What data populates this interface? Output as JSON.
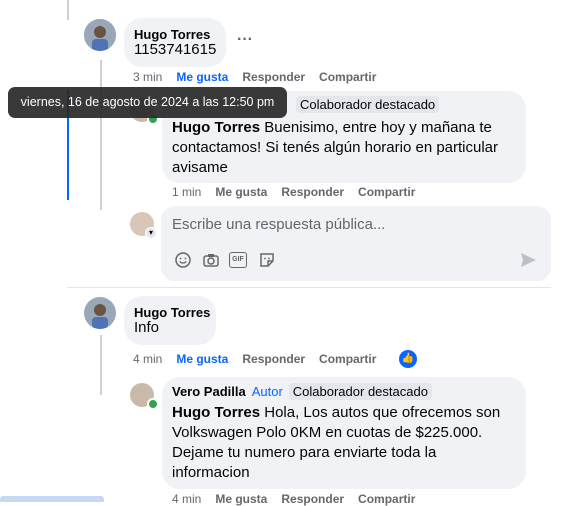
{
  "comments": [
    {
      "author": "Hugo Torres",
      "text": "1153741615",
      "meta": {
        "time": "3 min",
        "like": "Me gusta",
        "reply": "Responder",
        "share": "Compartir"
      },
      "more_glyph": "···"
    },
    {
      "author": "Hugo Torres",
      "text": "Info",
      "meta": {
        "time": "4 min",
        "like": "Me gusta",
        "reply": "Responder",
        "share": "Compartir"
      }
    }
  ],
  "replies": [
    {
      "badge": "Colaborador destacado",
      "mention": "Hugo Torres",
      "text": " Buenisimo, entre hoy y mañana te contactamos! Si tenés algún horario en particular avisame",
      "meta": {
        "time": "1 min",
        "like": "Me gusta",
        "reply": "Responder",
        "share": "Compartir"
      }
    },
    {
      "author": "Vero Padilla",
      "role": "Autor",
      "badge": "Colaborador destacado",
      "mention": "Hugo Torres",
      "text": " Hola, Los autos que ofrecemos son Volkswagen Polo 0KM en cuotas de $225.000. Dejame tu numero para enviarte toda la informacion",
      "meta": {
        "time": "4 min",
        "like": "Me gusta",
        "reply": "Responder",
        "share": "Compartir"
      }
    }
  ],
  "tooltip": "viernes, 16 de agosto de 2024 a las 12:50 pm",
  "reply_box": {
    "placeholder": "Escribe una respuesta pública...",
    "icons": [
      "emoji-icon",
      "camera-icon",
      "gif-icon",
      "sticker-icon",
      "send-icon"
    ],
    "gif_label": "GIF"
  },
  "colors": {
    "accent": "#0866ff",
    "bubble": "#f0f2f5",
    "meta": "#65676b"
  }
}
